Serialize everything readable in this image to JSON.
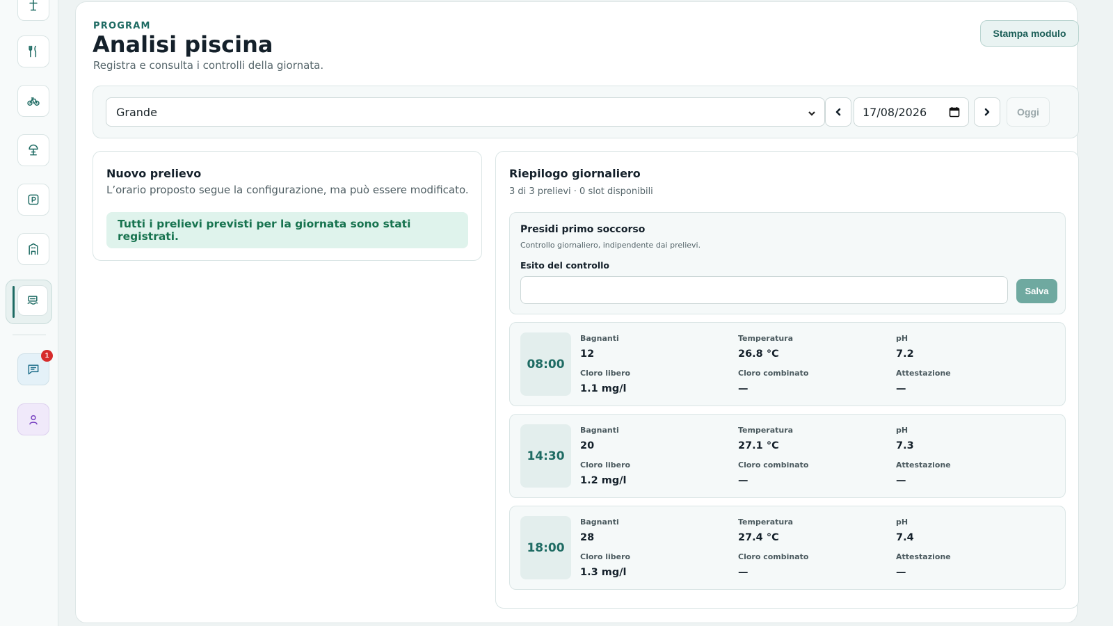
{
  "sidebar": {
    "items": [
      {
        "icon": "lifeguard-icon"
      },
      {
        "icon": "restaurant-icon"
      },
      {
        "icon": "bicycle-icon"
      },
      {
        "icon": "beach-umbrella-icon"
      },
      {
        "icon": "parking-icon"
      },
      {
        "icon": "building-icon"
      },
      {
        "icon": "pool-icon",
        "active": true
      },
      {
        "icon": "chat-icon",
        "badge": "1"
      },
      {
        "icon": "user-icon"
      }
    ]
  },
  "header": {
    "eyebrow": "PROGRAM",
    "title": "Analisi piscina",
    "subtitle": "Registra e consulta i controlli della giornata.",
    "print_label": "Stampa modulo"
  },
  "filters": {
    "pool_selected": "Grande",
    "date_value": "17/08/2026",
    "today_label": "Oggi"
  },
  "new_sample": {
    "title": "Nuovo prelievo",
    "description": "L’orario proposto segue la configurazione, ma può essere modificato.",
    "complete_message": "Tutti i prelievi previsti per la giornata sono stati registrati."
  },
  "summary": {
    "title": "Riepilogo giornaliero",
    "subtitle": "3 di 3 prelievi · 0 slot disponibili",
    "first_aid": {
      "title": "Presidi primo soccorso",
      "note": "Controllo giornaliero, indipendente dai prelievi.",
      "field_label": "Esito del controllo",
      "field_value": "",
      "save_label": "Salva"
    },
    "labels": {
      "bathers": "Bagnanti",
      "temperature": "Temperatura",
      "ph": "pH",
      "free_chlorine": "Cloro libero",
      "combined_chlorine": "Cloro combinato",
      "attestation": "Attestazione"
    },
    "samples": [
      {
        "time": "08:00",
        "bathers": "12",
        "temperature": "26.8 °C",
        "ph": "7.2",
        "free_chlorine": "1.1 mg/l",
        "combined_chlorine": "—",
        "attestation": "—"
      },
      {
        "time": "14:30",
        "bathers": "20",
        "temperature": "27.1 °C",
        "ph": "7.3",
        "free_chlorine": "1.2 mg/l",
        "combined_chlorine": "—",
        "attestation": "—"
      },
      {
        "time": "18:00",
        "bathers": "28",
        "temperature": "27.4 °C",
        "ph": "7.4",
        "free_chlorine": "1.3 mg/l",
        "combined_chlorine": "—",
        "attestation": "—"
      }
    ]
  },
  "colors": {
    "accent": "#1e6b63",
    "success_bg": "#dff3ec",
    "success_text": "#17734f",
    "badge": "#d62b2b"
  }
}
